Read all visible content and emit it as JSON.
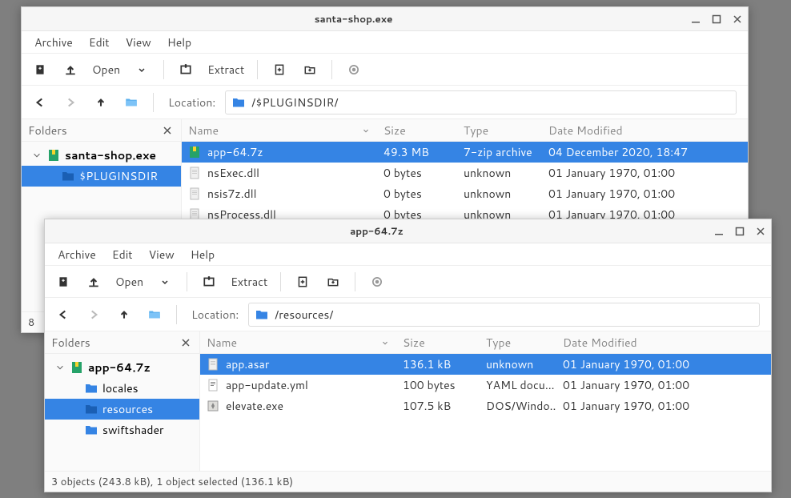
{
  "menu": {
    "archive": "Archive",
    "edit": "Edit",
    "view": "View",
    "help": "Help"
  },
  "toolbar": {
    "open": "Open",
    "extract": "Extract"
  },
  "nav": {
    "location_label": "Location:"
  },
  "folders_label": "Folders",
  "columns": {
    "name": "Name",
    "size": "Size",
    "type": "Type",
    "date": "Date Modified"
  },
  "win1": {
    "title": "santa-shop.exe",
    "location": "/$PLUGINSDIR/",
    "tree": [
      {
        "label": "santa-shop.exe",
        "depth": 0,
        "expanded": true,
        "icon": "archive",
        "bold": true,
        "selected": false
      },
      {
        "label": "$PLUGINSDIR",
        "depth": 1,
        "expanded": false,
        "icon": "folder",
        "bold": false,
        "selected": true
      }
    ],
    "files": [
      {
        "name": "app-64.7z",
        "size": "49.3 MB",
        "type": "7-zip archive",
        "date": "04 December 2020, 18:47",
        "icon": "archive",
        "selected": true
      },
      {
        "name": "nsExec.dll",
        "size": "0 bytes",
        "type": "unknown",
        "date": "01 January 1970, 01:00",
        "icon": "file",
        "selected": false
      },
      {
        "name": "nsis7z.dll",
        "size": "0 bytes",
        "type": "unknown",
        "date": "01 January 1970, 01:00",
        "icon": "file",
        "selected": false
      },
      {
        "name": "nsProcess.dll",
        "size": "0 bytes",
        "type": "unknown",
        "date": "01 January 1970, 01:00",
        "icon": "file",
        "selected": false
      }
    ],
    "status": "8"
  },
  "win2": {
    "title": "app-64.7z",
    "location": "/resources/",
    "tree": [
      {
        "label": "app-64.7z",
        "depth": 0,
        "expanded": true,
        "icon": "archive",
        "bold": true,
        "selected": false
      },
      {
        "label": "locales",
        "depth": 1,
        "expanded": false,
        "icon": "folder",
        "bold": false,
        "selected": false
      },
      {
        "label": "resources",
        "depth": 1,
        "expanded": false,
        "icon": "folder",
        "bold": false,
        "selected": true
      },
      {
        "label": "swiftshader",
        "depth": 1,
        "expanded": false,
        "icon": "folder",
        "bold": false,
        "selected": false
      }
    ],
    "files": [
      {
        "name": "app.asar",
        "size": "136.1 kB",
        "type": "unknown",
        "date": "01 January 1970, 01:00",
        "icon": "file",
        "selected": true
      },
      {
        "name": "app-update.yml",
        "size": "100 bytes",
        "type": "YAML docu…",
        "date": "01 January 1970, 01:00",
        "icon": "text",
        "selected": false
      },
      {
        "name": "elevate.exe",
        "size": "107.5 kB",
        "type": "DOS/Windo…",
        "date": "01 January 1970, 01:00",
        "icon": "exe",
        "selected": false
      }
    ],
    "status": "3 objects (243.8 kB), 1 object selected (136.1 kB)"
  }
}
